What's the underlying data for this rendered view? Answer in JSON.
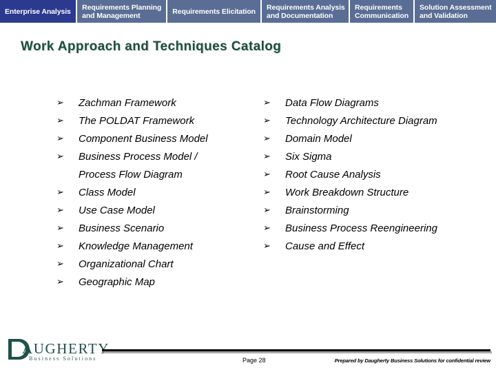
{
  "tabs": [
    {
      "id": "enterprise-analysis",
      "lines": [
        "Enterprise Analysis"
      ],
      "active": true,
      "width": 111
    },
    {
      "id": "requirements-planning-and-management",
      "lines": [
        "Requirements Planning",
        "and Management"
      ],
      "active": false,
      "width": 130
    },
    {
      "id": "requirements-elicitation",
      "lines": [
        "Requirements Elicitation"
      ],
      "active": false,
      "width": 135
    },
    {
      "id": "requirements-analysis-and-documentation",
      "lines": [
        "Requirements Analysis",
        "and Documentation"
      ],
      "active": false,
      "width": 126
    },
    {
      "id": "requirements-communication",
      "lines": [
        "Requirements",
        "Communication"
      ],
      "active": false,
      "width": 92
    },
    {
      "id": "solution-assessment-and-validation",
      "lines": [
        "Solution Assessment",
        "and Validation"
      ],
      "active": false,
      "width": 118
    }
  ],
  "title": "Work Approach and Techniques Catalog",
  "bullet_marker": "➢",
  "left_column": [
    {
      "marker": true,
      "text": "Zachman Framework"
    },
    {
      "marker": true,
      "text": "The POLDAT Framework"
    },
    {
      "marker": true,
      "text": "Component Business Model"
    },
    {
      "marker": true,
      "text": "Business Process Model /"
    },
    {
      "marker": false,
      "text": "Process Flow Diagram"
    },
    {
      "marker": true,
      "text": "Class Model"
    },
    {
      "marker": true,
      "text": "Use Case Model"
    },
    {
      "marker": true,
      "text": "Business Scenario"
    },
    {
      "marker": true,
      "text": "Knowledge Management"
    },
    {
      "marker": true,
      "text": "Organizational Chart"
    },
    {
      "marker": true,
      "text": "Geographic Map"
    }
  ],
  "right_column": [
    {
      "marker": true,
      "text": "Data Flow Diagrams"
    },
    {
      "marker": true,
      "text": "Technology Architecture Diagram"
    },
    {
      "marker": true,
      "text": "Domain Model"
    },
    {
      "marker": true,
      "text": "Six Sigma"
    },
    {
      "marker": true,
      "text": "Root Cause Analysis"
    },
    {
      "marker": true,
      "text": "Work Breakdown Structure"
    },
    {
      "marker": true,
      "text": "Brainstorming"
    },
    {
      "marker": true,
      "text": "Business Process Reengineering"
    },
    {
      "marker": true,
      "text": "Cause and Effect"
    }
  ],
  "footer": {
    "logo_word": "AUGHERTY",
    "logo_tagline": "Business Solutions",
    "page_label": "Page 28",
    "confidential_note": "Prepared by Daugherty Business Solutions for confidential review"
  },
  "colors": {
    "tab_inactive": "#5a6d94",
    "tab_active": "#2b3a8f",
    "title_green": "#1f4d40",
    "logo_green": "#1f5149"
  }
}
